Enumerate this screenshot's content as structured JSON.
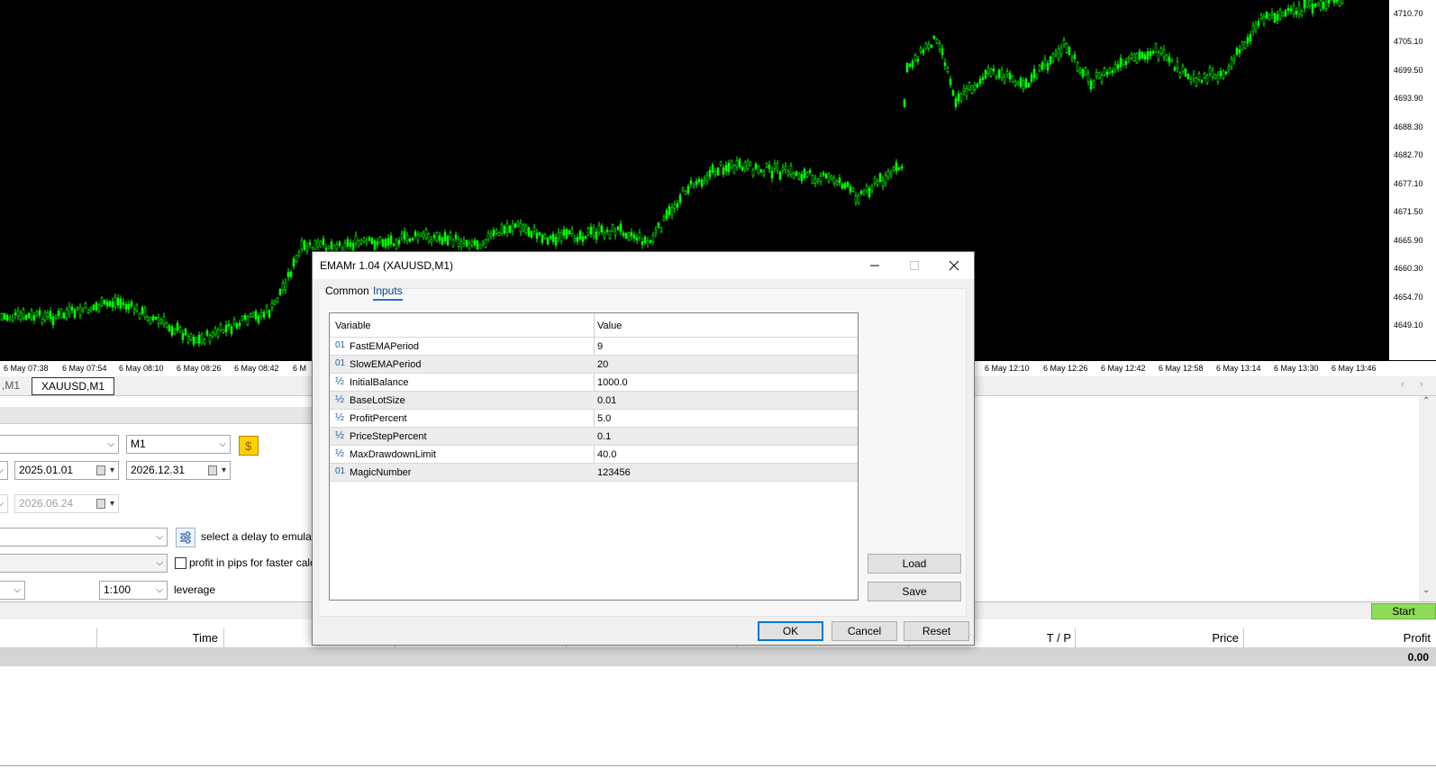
{
  "chart": {
    "background": "#000000",
    "candle_color": "#00ff00",
    "price_labels": [
      "4710.70",
      "4705.10",
      "4699.50",
      "4693.90",
      "4688.30",
      "4682.70",
      "4677.10",
      "4671.50",
      "4665.90",
      "4660.30",
      "4654.70",
      "4649.10"
    ],
    "time_labels": [
      "6 May 07:38",
      "6 May 07:54",
      "6 May 08:10",
      "6 May 08:26",
      "6 May 08:42",
      "6 M",
      "6 May 12:10",
      "6 May 12:26",
      "6 May 12:42",
      "6 May 12:58",
      "6 May 13:14",
      "6 May 13:30",
      "6 May 13:46"
    ]
  },
  "chart_tabs": {
    "prev_tab": ",M1",
    "active_tab": "XAUUSD,M1",
    "scroll_left": "‹",
    "scroll_right": "›"
  },
  "tester": {
    "period": "M1",
    "date_from": "2025.01.01",
    "date_to": "2026.12.31",
    "forward_date": "2026.06.24",
    "delay_text": "select a delay to emulate s",
    "pips_text": "profit in pips for faster calcula",
    "leverage": "1:100",
    "leverage_label": "leverage",
    "start_label": "Start",
    "start_color": "#8fdc58"
  },
  "results": {
    "columns": [
      "Time",
      "T / P",
      "Price",
      "Profit"
    ],
    "total": "0.00"
  },
  "dialog": {
    "title": "EMAMr 1.04 (XAUUSD,M1)",
    "minimize": "—",
    "maximize": "☐",
    "close": "✕",
    "tabs": [
      "Common",
      "Inputs"
    ],
    "active_tab": "Inputs",
    "grid_headers": {
      "variable": "Variable",
      "value": "Value"
    },
    "params": [
      {
        "icon": "01",
        "name": "FastEMAPeriod",
        "value": "9"
      },
      {
        "icon": "01",
        "name": "SlowEMAPeriod",
        "value": "20"
      },
      {
        "icon": "½",
        "name": "InitialBalance",
        "value": "1000.0"
      },
      {
        "icon": "½",
        "name": "BaseLotSize",
        "value": "0.01"
      },
      {
        "icon": "½",
        "name": "ProfitPercent",
        "value": "5.0"
      },
      {
        "icon": "½",
        "name": "PriceStepPercent",
        "value": "0.1"
      },
      {
        "icon": "½",
        "name": "MaxDrawdownLimit",
        "value": "40.0"
      },
      {
        "icon": "01",
        "name": "MagicNumber",
        "value": "123456"
      }
    ],
    "buttons": {
      "load": "Load",
      "save": "Save",
      "ok": "OK",
      "cancel": "Cancel",
      "reset": "Reset"
    },
    "accent": "#0078d7"
  }
}
